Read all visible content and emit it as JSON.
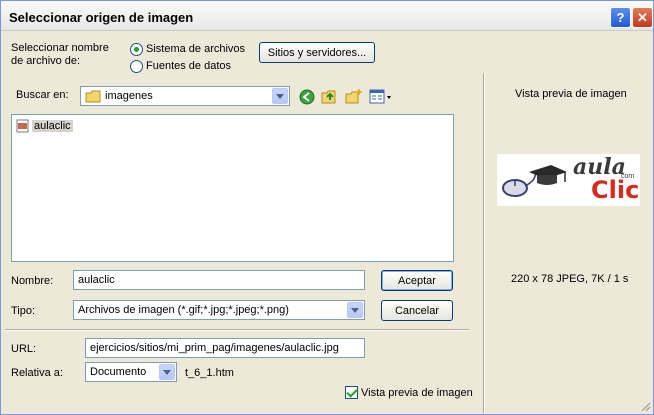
{
  "window": {
    "title": "Seleccionar origen de imagen",
    "help_glyph": "?",
    "close_glyph": "✕"
  },
  "source": {
    "label": "Seleccionar nombre de archivo de:",
    "option_filesystem": "Sistema de archivos",
    "option_datasource": "Fuentes de datos",
    "selected": "Sistema de archivos",
    "sites_button": "Sitios y servidores..."
  },
  "lookin": {
    "label": "Buscar en:",
    "value": "imagenes"
  },
  "files": [
    {
      "name": "aulaclic",
      "selected": true
    }
  ],
  "name_field": {
    "label": "Nombre:",
    "value": "aulaclic"
  },
  "type_field": {
    "label": "Tipo:",
    "value": "Archivos de imagen (*.gif;*.jpg;*.jpeg;*.png)"
  },
  "buttons": {
    "accept": "Aceptar",
    "cancel": "Cancelar"
  },
  "url_field": {
    "label": "URL:",
    "value": "ejercicios/sitios/mi_prim_pag/imagenes/aulaclic.jpg"
  },
  "relative": {
    "label": "Relativa a:",
    "value": "Documento",
    "document": "t_6_1.htm"
  },
  "preview": {
    "heading": "Vista previa de imagen",
    "info": "220 x 78 JPEG, 7K / 1 s",
    "logo_word1": "aula",
    "logo_small": "com",
    "logo_word2": "Clic",
    "checkbox_label": "Vista previa de imagen",
    "checkbox_checked": true
  },
  "colors": {
    "accent": "#316ac5",
    "logo_red": "#d8291c"
  }
}
